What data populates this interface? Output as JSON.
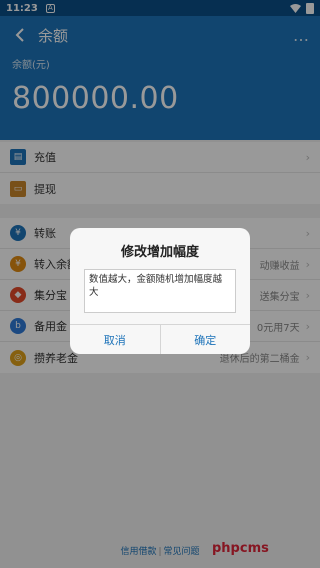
{
  "status_bar": {
    "time": "11:23",
    "notification_badge": "A"
  },
  "header": {
    "title": "余额",
    "more_icon": "…",
    "balance_label": "余额(元)",
    "balance_value": "800000.00"
  },
  "group1": [
    {
      "icon": "recharge-icon",
      "label": "充值",
      "icon_color": "#1d73b9"
    },
    {
      "icon": "withdraw-icon",
      "label": "提现",
      "icon_color": "#c8862a"
    }
  ],
  "group2": [
    {
      "icon": "transfer-icon",
      "label": "转账",
      "desc": "",
      "icon_color": "#1d73b9"
    },
    {
      "icon": "yuebao-icon",
      "label": "转入余额",
      "desc": "动赚收益",
      "icon_color": "#e08a12"
    },
    {
      "icon": "jifenbao-icon",
      "label": "集分宝",
      "desc": "送集分宝",
      "icon_color": "#e34a2a"
    },
    {
      "icon": "beiyongjin-icon",
      "label": "备用金",
      "desc": "0元用7天",
      "icon_color": "#2f7ad8"
    },
    {
      "icon": "pension-icon",
      "label": "攒养老金",
      "desc": "退休后的第二桶金",
      "icon_color": "#e0a11a"
    }
  ],
  "footer": {
    "link1": "信用借款",
    "separator": "|",
    "link2": "常见问题"
  },
  "watermark": "phpcms",
  "dialog": {
    "title": "修改增加幅度",
    "input_value": "数值越大，金额随机增加幅度越大",
    "cancel_label": "取消",
    "confirm_label": "确定"
  }
}
